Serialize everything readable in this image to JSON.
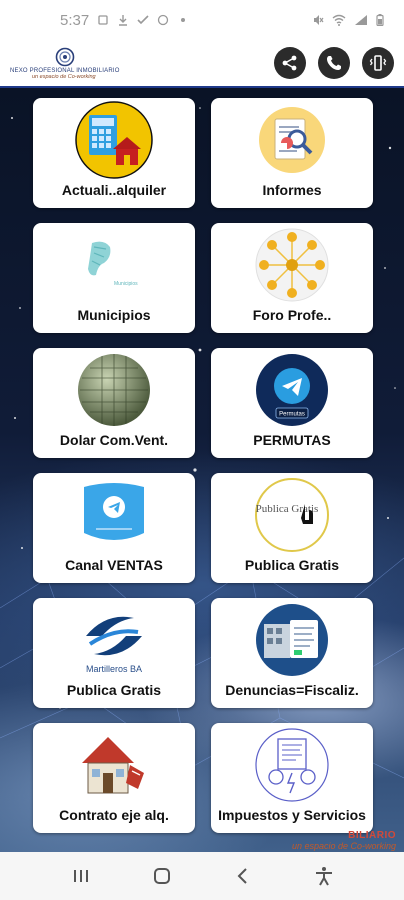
{
  "status_bar": {
    "time": "5:37",
    "icons_left": [
      "notification-icon",
      "download-icon",
      "check-icon",
      "whatsapp-icon",
      "dot-icon"
    ],
    "icons_right": [
      "mute-icon",
      "wifi-icon",
      "signal-icon",
      "battery-icon"
    ]
  },
  "header": {
    "logo_title": "NEXO PROFESIONAL INMOBILIARIO",
    "logo_subtitle": "un espacio de Co-working",
    "actions": [
      "share-icon",
      "whatsapp-icon",
      "vibrate-icon"
    ]
  },
  "tiles": [
    {
      "label": "Actuali..alquiler",
      "icon": "calculator-house-icon"
    },
    {
      "label": "Informes",
      "icon": "report-chart-icon"
    },
    {
      "label": "Municipios",
      "icon": "municipios-logo-icon"
    },
    {
      "label": "Foro Profe..",
      "icon": "network-people-icon"
    },
    {
      "label": "Dolar Com.Vent.",
      "icon": "dollar-globe-icon"
    },
    {
      "label": "PERMUTAS",
      "icon": "telegram-permutas-icon"
    },
    {
      "label": "Canal VENTAS",
      "icon": "telegram-tablet-icon"
    },
    {
      "label": "Publica Gratis",
      "icon": "publica-gratis-hand-icon"
    },
    {
      "label": "Publica Gratis",
      "icon": "martilleros-ba-icon"
    },
    {
      "label": "Denuncias=Fiscaliz.",
      "icon": "building-document-icon"
    },
    {
      "label": "Contrato eje alq.",
      "icon": "house-sale-icon"
    },
    {
      "label": "Impuestos y Servicios",
      "icon": "taxes-services-icon"
    }
  ],
  "tile_extra_text": {
    "municipios_caption": "Municipios",
    "permutas_caption": "Permutas",
    "publica_gratis_text": "Publica Gratis",
    "martilleros_text": "Martilleros BA"
  },
  "watermark": {
    "line1": "BILIARIO",
    "line2": "un espacio de Co-working"
  },
  "colors": {
    "header_border": "#1f3a8a",
    "tile_bg": "#ffffff",
    "brand_dark": "#2b2b2b"
  }
}
